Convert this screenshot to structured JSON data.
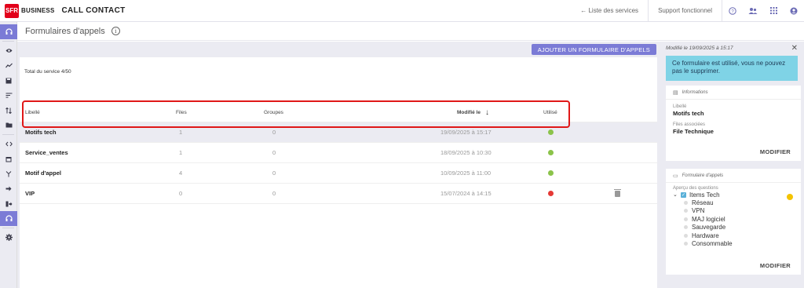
{
  "brand": {
    "logo": "SFR",
    "business": "BUSINESS",
    "app_title": "CALL CONTACT"
  },
  "topbar": {
    "services_link": "← Liste des services",
    "support_link": "Support fonctionnel",
    "icons": [
      "help-icon",
      "users-icon",
      "apps-grid-icon",
      "account-icon"
    ]
  },
  "sidebar": {
    "icons": [
      "headset-icon",
      "eye-icon",
      "trend-icon",
      "save-icon",
      "filter-icon",
      "sort-icon",
      "folder-icon",
      "code-icon",
      "calendar-icon",
      "branch-icon",
      "forward-icon",
      "transfer-icon",
      "headset-active-icon",
      "settings-icon"
    ]
  },
  "page": {
    "title": "Formulaires d'appels"
  },
  "toolbar": {
    "add_button": "AJOUTER UN FORMULAIRE D'APPELS"
  },
  "summary": {
    "total": "Total du service 4/50"
  },
  "table": {
    "headers": {
      "libelle": "Libellé",
      "files": "Files",
      "groupes": "Groupes",
      "modified": "Modifié le",
      "used": "Utilisé"
    },
    "rows": [
      {
        "libelle": "Motifs tech",
        "files": "1",
        "groupes": "0",
        "modified": "19/09/2025 à 15:17",
        "used": true,
        "deletable": false
      },
      {
        "libelle": "Service_ventes",
        "files": "1",
        "groupes": "0",
        "modified": "18/09/2025 à 10:30",
        "used": true,
        "deletable": false
      },
      {
        "libelle": "Motif d'appel",
        "files": "4",
        "groupes": "0",
        "modified": "10/09/2025 à 11:00",
        "used": true,
        "deletable": false
      },
      {
        "libelle": "VIP",
        "files": "0",
        "groupes": "0",
        "modified": "15/07/2024 à 14:15",
        "used": false,
        "deletable": true
      }
    ]
  },
  "colors": {
    "accent": "#7b7bd6",
    "used": "#8bc34a",
    "unused": "#e53935",
    "alert_bg": "#7fd3e6",
    "highlight": "#e01818"
  },
  "detail": {
    "modified_info": "Modifié le 19/09/2025 à 15:17",
    "alert": "Ce formulaire est utilisé, vous ne pouvez pas le supprimer.",
    "info_card": {
      "title": "Informations",
      "label_libelle": "Libellé",
      "value_libelle": "Motifs tech",
      "label_files": "Files associées",
      "value_files": "File Technique",
      "button": "MODIFIER"
    },
    "form_card": {
      "title": "Formulaire d'appels",
      "label": "Aperçu des questions",
      "root": "Items Tech",
      "children": [
        "Réseau",
        "VPN",
        "MAJ logiciel",
        "Sauvegarde",
        "Hardware",
        "Consommable"
      ],
      "button": "MODIFIER"
    }
  }
}
